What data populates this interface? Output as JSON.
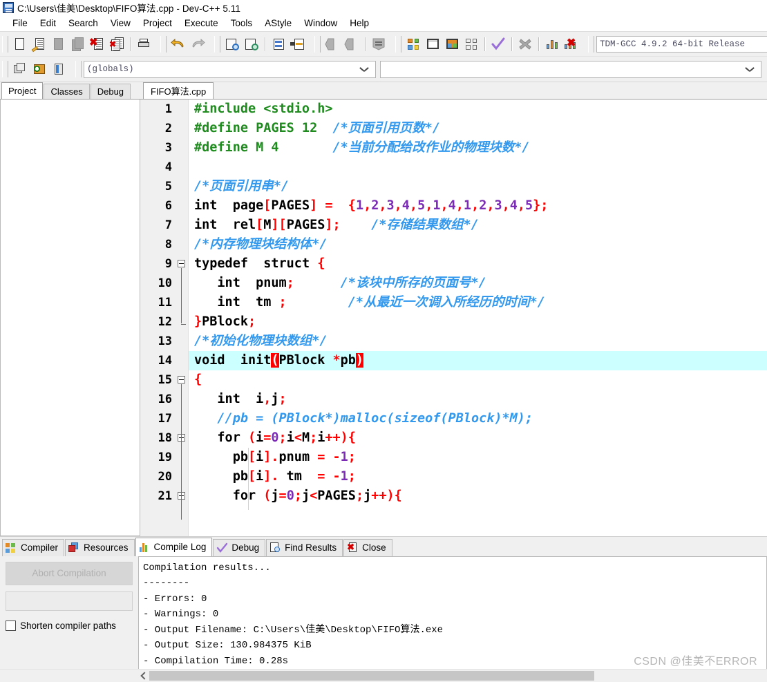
{
  "window": {
    "title": "C:\\Users\\佳美\\Desktop\\FIFO算法.cpp - Dev-C++ 5.11",
    "app_icon": "devcpp-icon"
  },
  "menubar": {
    "items": [
      {
        "label": "File"
      },
      {
        "label": "Edit"
      },
      {
        "label": "Search"
      },
      {
        "label": "View"
      },
      {
        "label": "Project"
      },
      {
        "label": "Execute"
      },
      {
        "label": "Tools"
      },
      {
        "label": "AStyle"
      },
      {
        "label": "Window"
      },
      {
        "label": "Help"
      }
    ]
  },
  "toolbar": {
    "buttons": [
      {
        "name": "new-file-icon",
        "tip": "New"
      },
      {
        "name": "open-file-icon",
        "tip": "Open"
      },
      {
        "name": "save-icon",
        "tip": "Save"
      },
      {
        "name": "save-all-icon",
        "tip": "Save All"
      },
      {
        "name": "close-file-icon",
        "tip": "Close"
      },
      {
        "name": "close-all-icon",
        "tip": "Close All"
      },
      {
        "name": "print-icon",
        "tip": "Print"
      },
      {
        "name": "undo-icon",
        "tip": "Undo"
      },
      {
        "name": "redo-icon",
        "tip": "Redo"
      },
      {
        "name": "find-icon",
        "tip": "Find"
      },
      {
        "name": "replace-icon",
        "tip": "Replace"
      },
      {
        "name": "goto-line-icon",
        "tip": "Goto Line"
      },
      {
        "name": "toggle-bookmark-icon",
        "tip": "Toggle Bookmark"
      },
      {
        "name": "back-icon",
        "tip": "Back"
      },
      {
        "name": "forward-icon",
        "tip": "Forward"
      },
      {
        "name": "options-icon",
        "tip": "Options"
      },
      {
        "name": "compile-icon",
        "tip": "Compile"
      },
      {
        "name": "run-icon",
        "tip": "Run"
      },
      {
        "name": "compile-run-icon",
        "tip": "Compile & Run"
      },
      {
        "name": "rebuild-all-icon",
        "tip": "Rebuild All"
      },
      {
        "name": "syntax-check-icon",
        "tip": "Syntax Check"
      },
      {
        "name": "stop-execution-icon",
        "tip": "Stop Execution"
      },
      {
        "name": "profile-icon",
        "tip": "Profile Analysis"
      },
      {
        "name": "delete-profile-icon",
        "tip": "Delete Profile"
      }
    ],
    "compiler_select": "TDM-GCC 4.9.2 64-bit Release",
    "row2_buttons": [
      {
        "name": "new-project-icon",
        "tip": "New Project"
      },
      {
        "name": "add-to-project-icon",
        "tip": "Add to Project"
      },
      {
        "name": "remove-from-project-icon",
        "tip": "Remove from Project"
      }
    ],
    "scope_select": "(globals)"
  },
  "left_panel": {
    "tabs": [
      {
        "label": "Project",
        "active": true
      },
      {
        "label": "Classes",
        "active": false
      },
      {
        "label": "Debug",
        "active": false
      }
    ]
  },
  "editor": {
    "tabs": [
      {
        "label": "FIFO算法.cpp",
        "active": true
      }
    ],
    "current_line": 14,
    "lines": [
      {
        "num": "1",
        "fold": "none",
        "tokens": [
          {
            "t": "#include <stdio.h>",
            "c": "pre"
          }
        ]
      },
      {
        "num": "2",
        "fold": "none",
        "tokens": [
          {
            "t": "#define PAGES 12",
            "c": "pre"
          },
          {
            "t": "  ",
            "c": "id"
          },
          {
            "t": "/*页面引用页数*/",
            "c": "cm"
          }
        ]
      },
      {
        "num": "3",
        "fold": "none",
        "tokens": [
          {
            "t": "#define M 4",
            "c": "pre"
          },
          {
            "t": "       ",
            "c": "id"
          },
          {
            "t": "/*当前分配给改作业的物理块数*/",
            "c": "cm"
          }
        ]
      },
      {
        "num": "4",
        "fold": "none",
        "tokens": []
      },
      {
        "num": "5",
        "fold": "none",
        "tokens": [
          {
            "t": "/*页面引用串*/",
            "c": "cm"
          }
        ]
      },
      {
        "num": "6",
        "fold": "none",
        "tokens": [
          {
            "t": "int",
            "c": "kw"
          },
          {
            "t": "  page",
            "c": "id"
          },
          {
            "t": "[",
            "c": "sym"
          },
          {
            "t": "PAGES",
            "c": "id"
          },
          {
            "t": "]",
            "c": "sym"
          },
          {
            "t": " ",
            "c": "id"
          },
          {
            "t": "=",
            "c": "sym"
          },
          {
            "t": "  ",
            "c": "id"
          },
          {
            "t": "{",
            "c": "sym"
          },
          {
            "t": "1",
            "c": "num"
          },
          {
            "t": ",",
            "c": "sym"
          },
          {
            "t": "2",
            "c": "num"
          },
          {
            "t": ",",
            "c": "sym"
          },
          {
            "t": "3",
            "c": "num"
          },
          {
            "t": ",",
            "c": "sym"
          },
          {
            "t": "4",
            "c": "num"
          },
          {
            "t": ",",
            "c": "sym"
          },
          {
            "t": "5",
            "c": "num"
          },
          {
            "t": ",",
            "c": "sym"
          },
          {
            "t": "1",
            "c": "num"
          },
          {
            "t": ",",
            "c": "sym"
          },
          {
            "t": "4",
            "c": "num"
          },
          {
            "t": ",",
            "c": "sym"
          },
          {
            "t": "1",
            "c": "num"
          },
          {
            "t": ",",
            "c": "sym"
          },
          {
            "t": "2",
            "c": "num"
          },
          {
            "t": ",",
            "c": "sym"
          },
          {
            "t": "3",
            "c": "num"
          },
          {
            "t": ",",
            "c": "sym"
          },
          {
            "t": "4",
            "c": "num"
          },
          {
            "t": ",",
            "c": "sym"
          },
          {
            "t": "5",
            "c": "num"
          },
          {
            "t": "};",
            "c": "sym"
          }
        ]
      },
      {
        "num": "7",
        "fold": "none",
        "tokens": [
          {
            "t": "int",
            "c": "kw"
          },
          {
            "t": "  rel",
            "c": "id"
          },
          {
            "t": "[",
            "c": "sym"
          },
          {
            "t": "M",
            "c": "id"
          },
          {
            "t": "][",
            "c": "sym"
          },
          {
            "t": "PAGES",
            "c": "id"
          },
          {
            "t": "];",
            "c": "sym"
          },
          {
            "t": "    ",
            "c": "id"
          },
          {
            "t": "/*存储结果数组*/",
            "c": "cm"
          }
        ]
      },
      {
        "num": "8",
        "fold": "none",
        "tokens": [
          {
            "t": "/*内存物理块结构体*/",
            "c": "cm"
          }
        ]
      },
      {
        "num": "9",
        "fold": "start",
        "tokens": [
          {
            "t": "typedef",
            "c": "kw"
          },
          {
            "t": "  ",
            "c": "id"
          },
          {
            "t": "struct",
            "c": "kw"
          },
          {
            "t": " ",
            "c": "id"
          },
          {
            "t": "{",
            "c": "sym"
          }
        ]
      },
      {
        "num": "10",
        "fold": "mid",
        "tokens": [
          {
            "t": "   ",
            "c": "id"
          },
          {
            "t": "int",
            "c": "kw"
          },
          {
            "t": "  pnum",
            "c": "id"
          },
          {
            "t": ";",
            "c": "sym"
          },
          {
            "t": "      ",
            "c": "id"
          },
          {
            "t": "/*该块中所存的页面号*/",
            "c": "cm"
          }
        ]
      },
      {
        "num": "11",
        "fold": "mid",
        "tokens": [
          {
            "t": "   ",
            "c": "id"
          },
          {
            "t": "int",
            "c": "kw"
          },
          {
            "t": "  tm ",
            "c": "id"
          },
          {
            "t": ";",
            "c": "sym"
          },
          {
            "t": "        ",
            "c": "id"
          },
          {
            "t": "/*从最近一次调入所经历的时间*/",
            "c": "cm"
          }
        ]
      },
      {
        "num": "12",
        "fold": "end",
        "tokens": [
          {
            "t": "}",
            "c": "sym"
          },
          {
            "t": "PBlock",
            "c": "id"
          },
          {
            "t": ";",
            "c": "sym"
          }
        ]
      },
      {
        "num": "13",
        "fold": "none",
        "tokens": [
          {
            "t": "/*初始化物理块数组*/",
            "c": "cm"
          }
        ]
      },
      {
        "num": "14",
        "fold": "none",
        "current": true,
        "tokens": [
          {
            "t": "void",
            "c": "kw"
          },
          {
            "t": "  init",
            "c": "id"
          },
          {
            "t": "(",
            "c": "mb"
          },
          {
            "t": "PBlock ",
            "c": "id"
          },
          {
            "t": "*",
            "c": "sym"
          },
          {
            "t": "pb",
            "c": "id"
          },
          {
            "t": ")",
            "c": "mb"
          }
        ]
      },
      {
        "num": "15",
        "fold": "start",
        "tokens": [
          {
            "t": "{",
            "c": "sym"
          }
        ]
      },
      {
        "num": "16",
        "fold": "mid",
        "tokens": [
          {
            "t": "   ",
            "c": "id"
          },
          {
            "t": "int",
            "c": "kw"
          },
          {
            "t": "  i",
            "c": "id"
          },
          {
            "t": ",",
            "c": "sym"
          },
          {
            "t": "j",
            "c": "id"
          },
          {
            "t": ";",
            "c": "sym"
          }
        ]
      },
      {
        "num": "17",
        "fold": "mid",
        "tokens": [
          {
            "t": "   ",
            "c": "id"
          },
          {
            "t": "//pb = (PBlock*)malloc(sizeof(PBlock)*M);",
            "c": "cm"
          }
        ]
      },
      {
        "num": "18",
        "fold": "start2",
        "tokens": [
          {
            "t": "   ",
            "c": "id"
          },
          {
            "t": "for",
            "c": "kw"
          },
          {
            "t": " ",
            "c": "id"
          },
          {
            "t": "(",
            "c": "sym"
          },
          {
            "t": "i",
            "c": "id"
          },
          {
            "t": "=",
            "c": "sym"
          },
          {
            "t": "0",
            "c": "num"
          },
          {
            "t": ";",
            "c": "sym"
          },
          {
            "t": "i",
            "c": "id"
          },
          {
            "t": "<",
            "c": "sym"
          },
          {
            "t": "M",
            "c": "id"
          },
          {
            "t": ";",
            "c": "sym"
          },
          {
            "t": "i",
            "c": "id"
          },
          {
            "t": "++){",
            "c": "sym"
          }
        ]
      },
      {
        "num": "19",
        "fold": "mid",
        "tokens": [
          {
            "t": "     pb",
            "c": "id"
          },
          {
            "t": "[",
            "c": "sym"
          },
          {
            "t": "i",
            "c": "id"
          },
          {
            "t": "].",
            "c": "sym"
          },
          {
            "t": "pnum ",
            "c": "id"
          },
          {
            "t": "=",
            "c": "sym"
          },
          {
            "t": " ",
            "c": "id"
          },
          {
            "t": "-",
            "c": "sym"
          },
          {
            "t": "1",
            "c": "num"
          },
          {
            "t": ";",
            "c": "sym"
          }
        ]
      },
      {
        "num": "20",
        "fold": "mid",
        "tokens": [
          {
            "t": "     pb",
            "c": "id"
          },
          {
            "t": "[",
            "c": "sym"
          },
          {
            "t": "i",
            "c": "id"
          },
          {
            "t": "].",
            "c": "sym"
          },
          {
            "t": " tm  ",
            "c": "id"
          },
          {
            "t": "=",
            "c": "sym"
          },
          {
            "t": " ",
            "c": "id"
          },
          {
            "t": "-",
            "c": "sym"
          },
          {
            "t": "1",
            "c": "num"
          },
          {
            "t": ";",
            "c": "sym"
          }
        ]
      },
      {
        "num": "21",
        "fold": "start2",
        "tokens": [
          {
            "t": "     ",
            "c": "id"
          },
          {
            "t": "for",
            "c": "kw"
          },
          {
            "t": " ",
            "c": "id"
          },
          {
            "t": "(",
            "c": "sym"
          },
          {
            "t": "j",
            "c": "id"
          },
          {
            "t": "=",
            "c": "sym"
          },
          {
            "t": "0",
            "c": "num"
          },
          {
            "t": ";",
            "c": "sym"
          },
          {
            "t": "j",
            "c": "id"
          },
          {
            "t": "<",
            "c": "sym"
          },
          {
            "t": "PAGES",
            "c": "id"
          },
          {
            "t": ";",
            "c": "sym"
          },
          {
            "t": "j",
            "c": "id"
          },
          {
            "t": "++){",
            "c": "sym"
          }
        ]
      }
    ]
  },
  "bottom_panel": {
    "tabs": [
      {
        "label": "Compiler",
        "icon": "compiler-icon",
        "active": false
      },
      {
        "label": "Resources",
        "icon": "resources-icon",
        "active": false
      },
      {
        "label": "Compile Log",
        "icon": "compile-log-icon",
        "active": true
      },
      {
        "label": "Debug",
        "icon": "debug-icon",
        "active": false
      },
      {
        "label": "Find Results",
        "icon": "find-results-icon",
        "active": false
      },
      {
        "label": "Close",
        "icon": "close-icon",
        "active": false
      }
    ],
    "abort_button": "Abort Compilation",
    "shorten_paths_label": "Shorten compiler paths",
    "shorten_paths_checked": false,
    "log_lines": [
      "Compilation results...",
      "--------",
      "- Errors: 0",
      "- Warnings: 0",
      "- Output Filename: C:\\Users\\佳美\\Desktop\\FIFO算法.exe",
      "- Output Size: 130.984375 KiB",
      "- Compilation Time: 0.28s"
    ]
  },
  "watermark": "CSDN @佳美不ERROR",
  "colors": {
    "preprocessor": "#1f8b1f",
    "comment": "#3399ee",
    "number": "#7b2bb5",
    "symbol": "#ff0000",
    "current_line_bg": "#ccffff",
    "match_brace_bg": "#ff0000"
  }
}
